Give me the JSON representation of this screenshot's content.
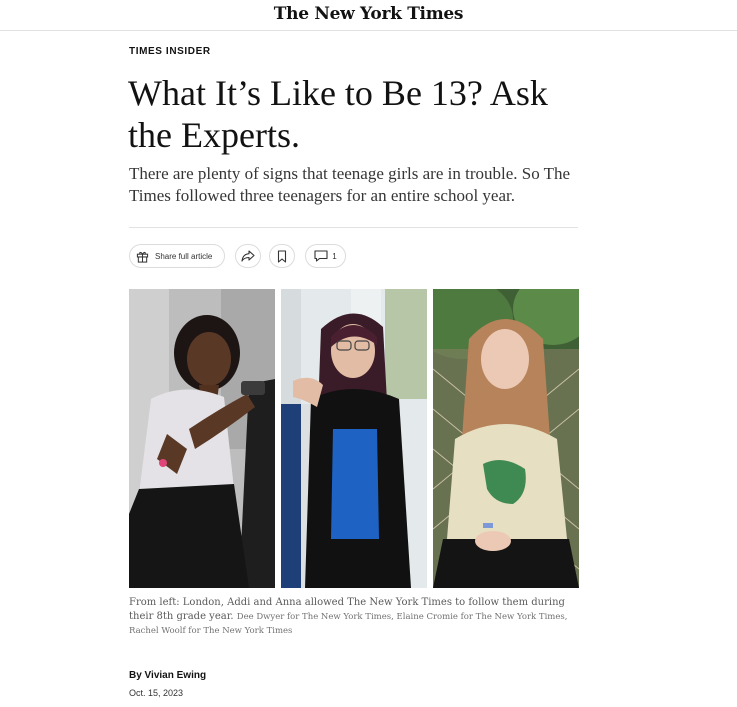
{
  "masthead": {
    "logo_text": "The New York Times"
  },
  "article": {
    "kicker": "TIMES INSIDER",
    "headline": "What It’s Like to Be 13? Ask the Experts.",
    "summary": "There are plenty of signs that teenage girls are in trouble. So The Times followed three teenagers for an entire school year."
  },
  "toolbar": {
    "share_label": "Share full article",
    "share_icon": "gift-icon",
    "forward_icon": "share-arrow-icon",
    "bookmark_icon": "bookmark-icon",
    "comment_icon": "comment-icon",
    "comment_count": "1"
  },
  "photos": [
    {
      "subject": "London"
    },
    {
      "subject": "Addi"
    },
    {
      "subject": "Anna"
    }
  ],
  "caption": {
    "text": "From left: London, Addi and Anna allowed The New York Times to follow them during their 8th grade year.",
    "credit": "Dee Dwyer for The New York Times, Elaine Cromie for The New York Times, Rachel Woolf for The New York Times"
  },
  "byline": "By Vivian Ewing",
  "date": "Oct. 15, 2023"
}
